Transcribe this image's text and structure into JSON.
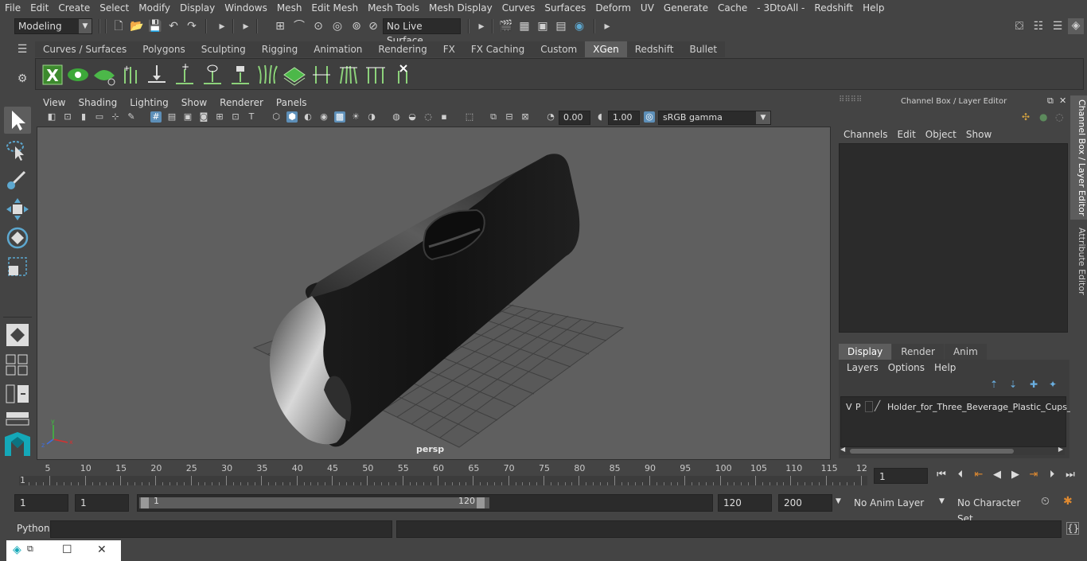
{
  "menubar": [
    "File",
    "Edit",
    "Create",
    "Select",
    "Modify",
    "Display",
    "Windows",
    "Mesh",
    "Edit Mesh",
    "Mesh Tools",
    "Mesh Display",
    "Curves",
    "Surfaces",
    "Deform",
    "UV",
    "Generate",
    "Cache",
    "- 3DtoAll -",
    "Redshift",
    "Help"
  ],
  "status": {
    "mode": "Modeling",
    "live_surface": "No Live Surface"
  },
  "shelf": {
    "tabs": [
      "Curves / Surfaces",
      "Polygons",
      "Sculpting",
      "Rigging",
      "Animation",
      "Rendering",
      "FX",
      "FX Caching",
      "Custom",
      "XGen",
      "Redshift",
      "Bullet"
    ],
    "active_tab": "XGen"
  },
  "viewport": {
    "menus": [
      "View",
      "Shading",
      "Lighting",
      "Show",
      "Renderer",
      "Panels"
    ],
    "exposure": "0.00",
    "gamma": "1.00",
    "color_space": "sRGB gamma",
    "camera": "persp",
    "background": "#5f5f5f",
    "grid_color": "#3f3f3f"
  },
  "right_panel": {
    "title": "Channel Box / Layer Editor",
    "menus": [
      "Channels",
      "Edit",
      "Object",
      "Show"
    ],
    "layer_tabs": [
      "Display",
      "Render",
      "Anim"
    ],
    "active_layer_tab": "Display",
    "layer_menus": [
      "Layers",
      "Options",
      "Help"
    ],
    "layer": {
      "v": "V",
      "p": "P",
      "name": "Holder_for_Three_Beverage_Plastic_Cups_Bl"
    },
    "side_tabs": [
      "Channel Box / Layer Editor",
      "Attribute Editor"
    ]
  },
  "timeline": {
    "ticks": [
      "5",
      "10",
      "15",
      "20",
      "25",
      "30",
      "35",
      "40",
      "45",
      "50",
      "55",
      "60",
      "65",
      "70",
      "75",
      "80",
      "85",
      "90",
      "95",
      "100",
      "105",
      "110",
      "115",
      "12"
    ],
    "start_label": "1",
    "current_frame": "1"
  },
  "range": {
    "start": "1",
    "playback_start": "1",
    "slider_start": "1",
    "slider_end": "120",
    "playback_end": "120",
    "end": "200",
    "anim_layer": "No Anim Layer",
    "character_set": "No Character Set"
  },
  "command": {
    "language": "Python"
  },
  "accent": "#5d8fb8"
}
